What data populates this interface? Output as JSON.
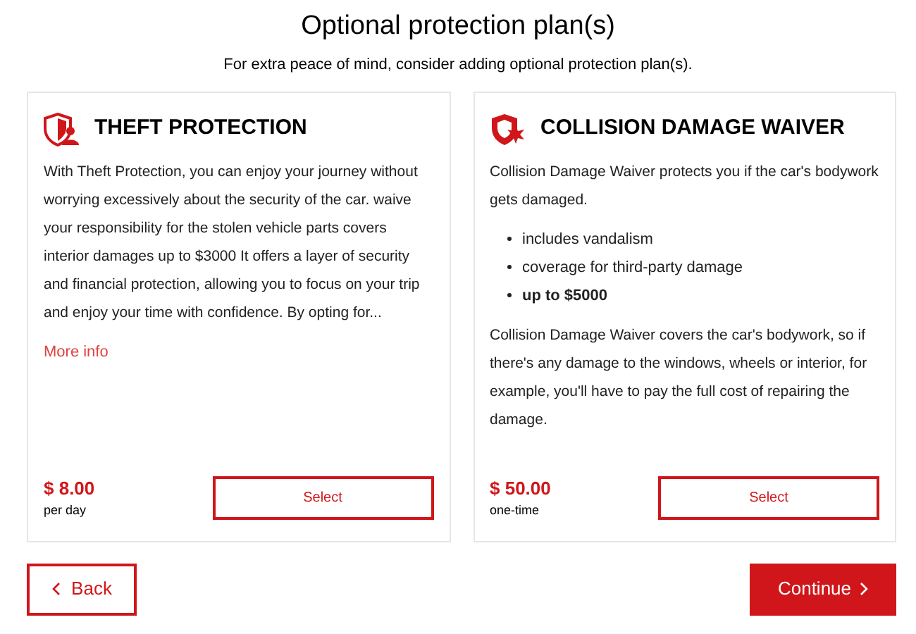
{
  "title": "Optional protection plan(s)",
  "subtitle": "For extra peace of mind, consider adding optional protection plan(s).",
  "plans": [
    {
      "name": "THEFT PROTECTION",
      "blocks": [
        {
          "kind": "paragraph",
          "text": "With Theft Protection, you can enjoy your journey without worrying excessively about the security of the car. waive your responsibility for the stolen vehicle parts covers interior damages up to $3000 It offers a layer of security and financial protection, allowing you to focus on your trip and enjoy your time with confidence. By opting for..."
        },
        {
          "kind": "link",
          "text": "More info"
        }
      ],
      "price": "$ 8.00",
      "period": "per day",
      "button": "Select"
    },
    {
      "name": "COLLISION DAMAGE WAIVER",
      "blocks": [
        {
          "kind": "paragraph",
          "text": "Collision Damage Waiver protects you if the car's bodywork gets damaged."
        },
        {
          "kind": "list",
          "items": [
            {
              "text": "includes vandalism",
              "bold": false
            },
            {
              "text": "coverage for third-party damage",
              "bold": false
            },
            {
              "text": "up to $5000",
              "bold": true
            }
          ]
        },
        {
          "kind": "paragraph",
          "text": "Collision Damage Waiver covers the car's bodywork, so if there's any damage to the windows, wheels or interior, for example, you'll have to pay the full cost of repairing the damage."
        }
      ],
      "price": "$ 50.00",
      "period": "one-time",
      "button": "Select"
    }
  ],
  "back": "Back",
  "continue": "Continue"
}
